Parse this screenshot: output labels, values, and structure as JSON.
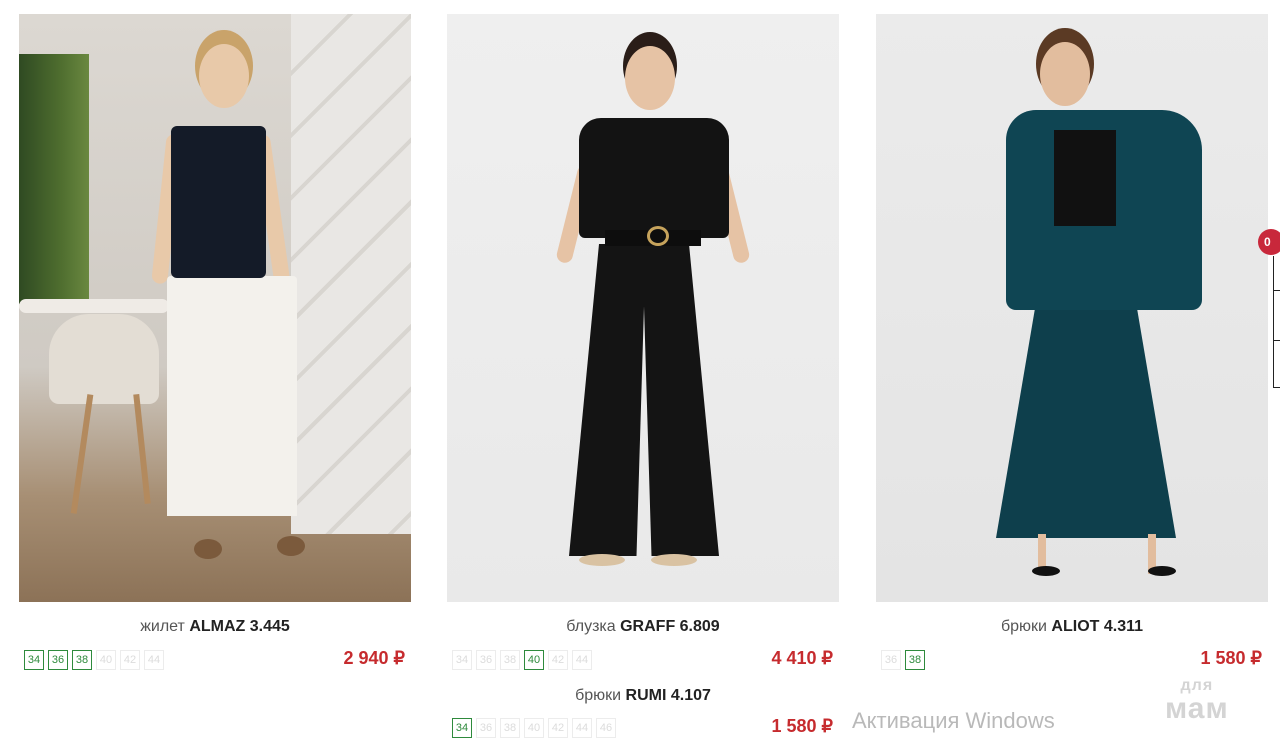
{
  "products": [
    {
      "type_label": "жилет",
      "model": "ALMAZ 3.445",
      "price": "2 940 ₽",
      "sizes": [
        {
          "label": "34",
          "available": true
        },
        {
          "label": "36",
          "available": true
        },
        {
          "label": "38",
          "available": true
        },
        {
          "label": "40",
          "available": false
        },
        {
          "label": "42",
          "available": false
        },
        {
          "label": "44",
          "available": false
        }
      ]
    },
    {
      "type_label": "блузка",
      "model": "GRAFF 6.809",
      "price": "4 410 ₽",
      "sizes": [
        {
          "label": "34",
          "available": false
        },
        {
          "label": "36",
          "available": false
        },
        {
          "label": "38",
          "available": false
        },
        {
          "label": "40",
          "available": true
        },
        {
          "label": "42",
          "available": false
        },
        {
          "label": "44",
          "available": false
        }
      ]
    },
    {
      "type_label": "брюки",
      "model": "ALIOT 4.311",
      "price": "1 580 ₽",
      "sizes": [
        {
          "label": "36",
          "available": false
        },
        {
          "label": "38",
          "available": true
        }
      ]
    }
  ],
  "set_item": {
    "type_label": "брюки",
    "model": "RUMI 4.107",
    "price": "1 580 ₽",
    "sizes": [
      {
        "label": "34",
        "available": true
      },
      {
        "label": "36",
        "available": false
      },
      {
        "label": "38",
        "available": false
      },
      {
        "label": "40",
        "available": false
      },
      {
        "label": "42",
        "available": false
      },
      {
        "label": "44",
        "available": false
      },
      {
        "label": "46",
        "available": false
      }
    ]
  },
  "cart_badge": "0",
  "os_watermark": "Активация Windows",
  "site_logo": {
    "line1": "для",
    "line2": "мам"
  },
  "colors": {
    "price": "#c62b2e",
    "size_available": "#2e8a3c",
    "badge": "#c8283b"
  }
}
